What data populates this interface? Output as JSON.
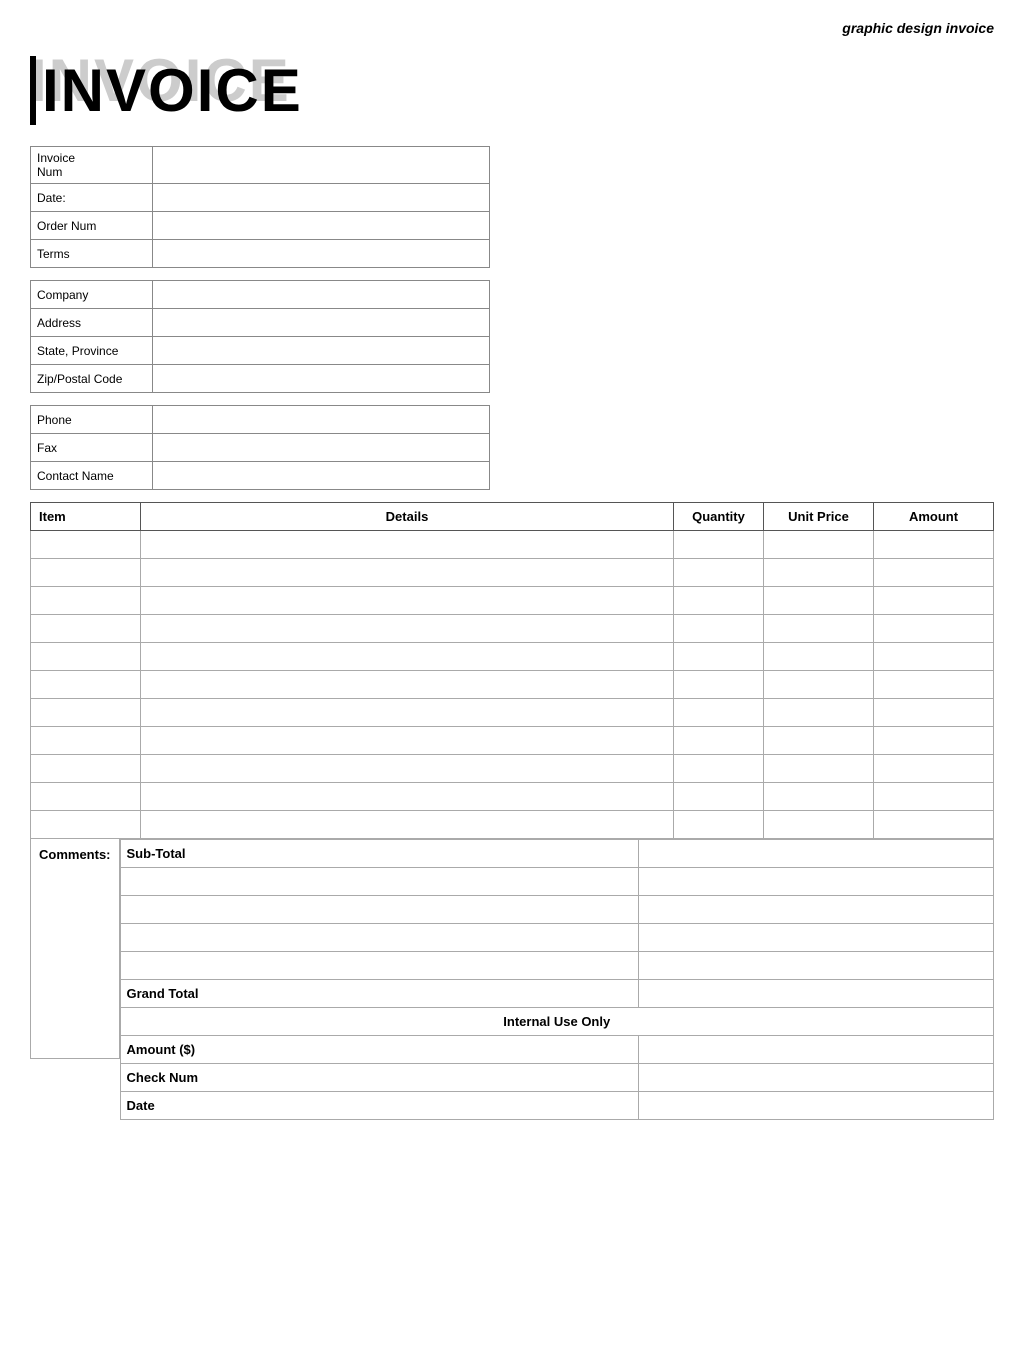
{
  "header": {
    "subtitle": "graphic design invoice"
  },
  "invoice_title": {
    "shadow_text": "INVOICE",
    "main_text": "INVOICE"
  },
  "info_section1": {
    "rows": [
      {
        "label": "Invoice Num",
        "value": ""
      },
      {
        "label": "Date:",
        "value": ""
      },
      {
        "label": "Order Num",
        "value": ""
      },
      {
        "label": "Terms",
        "value": ""
      }
    ]
  },
  "info_section2": {
    "rows": [
      {
        "label": "Company",
        "value": ""
      },
      {
        "label": "Address",
        "value": ""
      },
      {
        "label": "State, Province",
        "value": ""
      },
      {
        "label": "Zip/Postal Code",
        "value": ""
      }
    ]
  },
  "info_section3": {
    "rows": [
      {
        "label": "Phone",
        "value": ""
      },
      {
        "label": "Fax",
        "value": ""
      },
      {
        "label": "Contact Name",
        "value": ""
      }
    ]
  },
  "items_table": {
    "headers": {
      "item": "Item",
      "details": "Details",
      "quantity": "Quantity",
      "unit_price": "Unit Price",
      "amount": "Amount"
    },
    "rows": 11
  },
  "comments": {
    "label": "Comments:"
  },
  "totals": {
    "subtotal_label": "Sub-Total",
    "subtotal_value": "",
    "extra_rows": [
      "",
      "",
      "",
      ""
    ],
    "grand_total_label": "Grand Total",
    "grand_total_value": "",
    "internal_use_header": "Internal Use Only",
    "internal_rows": [
      {
        "label": "Amount ($)",
        "value": ""
      },
      {
        "label": "Check Num",
        "value": ""
      },
      {
        "label": "Date",
        "value": ""
      }
    ]
  }
}
